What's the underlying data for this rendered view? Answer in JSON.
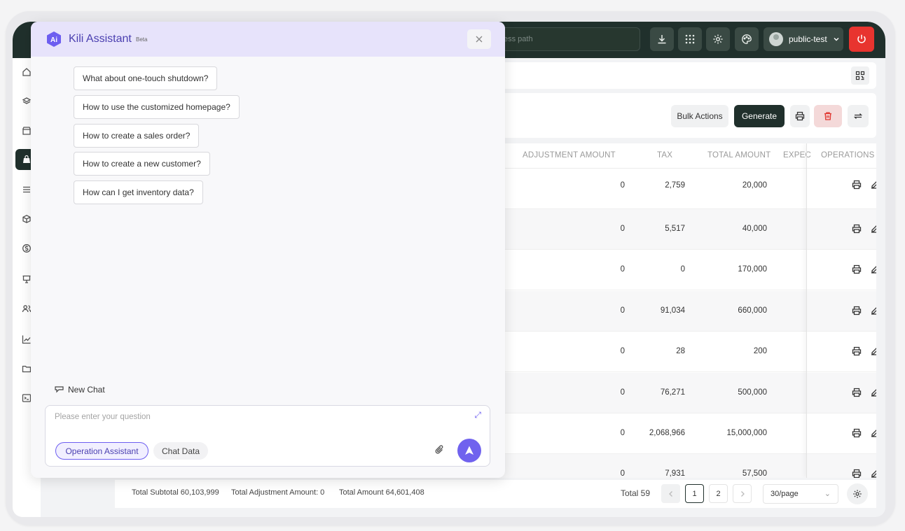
{
  "topbar": {
    "search_placeholder_tail": "ess path",
    "username": "public-test"
  },
  "assistant": {
    "title": "Kili Assistant",
    "beta": "Beta",
    "suggestions": [
      "What about one-touch shutdown?",
      "How to use the customized homepage?",
      "How to create a sales order?",
      "How to create a new customer?",
      "How can I get inventory data?"
    ],
    "new_chat": "New Chat",
    "input_placeholder": "Please enter your question",
    "chips": {
      "operation": "Operation Assistant",
      "chat_data": "Chat Data"
    }
  },
  "toolbar": {
    "bulk_actions": "Bulk Actions",
    "generate": "Generate"
  },
  "table": {
    "headers": {
      "adjustment": "ADJUSTMENT AMOUNT",
      "tax": "TAX",
      "total": "TOTAL AMOUNT",
      "expected": "EXPEC",
      "operations": "OPERATIONS"
    },
    "rows": [
      {
        "adjustment": "0",
        "tax": "2,759",
        "total": "20,000"
      },
      {
        "adjustment": "0",
        "tax": "5,517",
        "total": "40,000"
      },
      {
        "adjustment": "0",
        "tax": "0",
        "total": "170,000"
      },
      {
        "adjustment": "0",
        "tax": "91,034",
        "total": "660,000"
      },
      {
        "adjustment": "0",
        "tax": "28",
        "total": "200"
      },
      {
        "adjustment": "0",
        "tax": "76,271",
        "total": "500,000"
      },
      {
        "adjustment": "0",
        "tax": "2,068,966",
        "total": "15,000,000"
      },
      {
        "adjustment": "0",
        "tax": "7,931",
        "total": "57,500"
      }
    ]
  },
  "footer": {
    "subtotal": "Total Subtotal 60,103,999",
    "adjustment": "Total Adjustment Amount: 0",
    "amount": "Total Amount 64,601,408",
    "total_count": "Total 59",
    "pages": [
      "1",
      "2"
    ],
    "page_size": "30/page"
  },
  "colors": {
    "topbar": "#20302c",
    "accent": "#7062ee",
    "danger": "#e8342f"
  }
}
